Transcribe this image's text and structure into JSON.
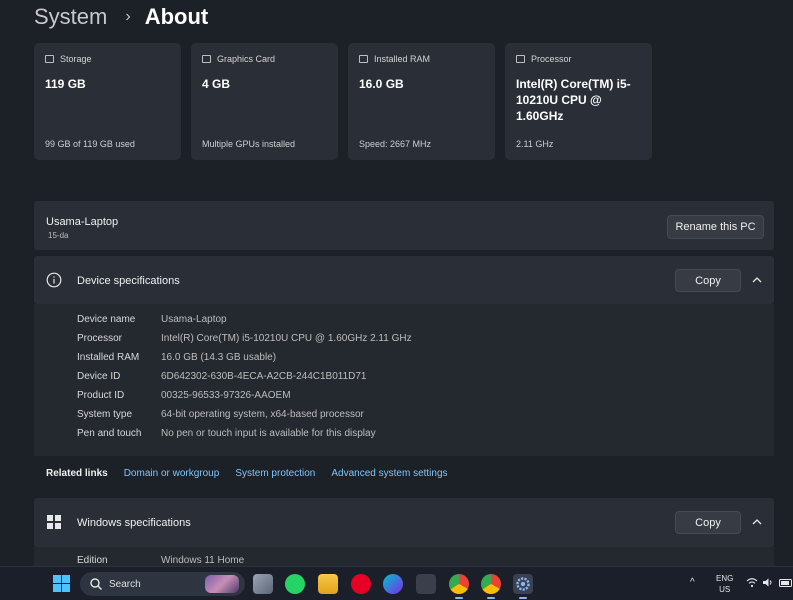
{
  "breadcrumb": {
    "parent": "System",
    "separator": "›",
    "current": "About"
  },
  "cards": [
    {
      "title": "Storage",
      "value": "119 GB",
      "sub": "99 GB of 119 GB used",
      "icon": "storage-icon"
    },
    {
      "title": "Graphics Card",
      "value": "4 GB",
      "sub": "Multiple GPUs installed",
      "icon": "graphics-card-icon"
    },
    {
      "title": "Installed RAM",
      "value": "16.0 GB",
      "sub": "Speed: 2667 MHz",
      "icon": "ram-icon"
    },
    {
      "title": "Processor",
      "value": "Intel(R) Core(TM) i5-10210U CPU @ 1.60GHz",
      "sub": "2.11 GHz",
      "icon": "processor-icon"
    }
  ],
  "pc": {
    "name": "Usama-Laptop",
    "model": "15-da",
    "rename_label": "Rename this PC"
  },
  "device_specs": {
    "title": "Device specifications",
    "copy_label": "Copy",
    "rows": [
      {
        "label": "Device name",
        "value": "Usama-Laptop"
      },
      {
        "label": "Processor",
        "value": "Intel(R) Core(TM) i5-10210U CPU @ 1.60GHz   2.11 GHz"
      },
      {
        "label": "Installed RAM",
        "value": "16.0 GB (14.3 GB usable)"
      },
      {
        "label": "Device ID",
        "value": "6D642302-630B-4ECA-A2CB-244C1B011D71"
      },
      {
        "label": "Product ID",
        "value": "00325-96533-97326-AAOEM"
      },
      {
        "label": "System type",
        "value": "64-bit operating system, x64-based processor"
      },
      {
        "label": "Pen and touch",
        "value": "No pen or touch input is available for this display"
      }
    ]
  },
  "related_links": {
    "title": "Related links",
    "links": [
      "Domain or workgroup",
      "System protection",
      "Advanced system settings"
    ]
  },
  "windows_specs": {
    "title": "Windows specifications",
    "copy_label": "Copy",
    "rows": [
      {
        "label": "Edition",
        "value": "Windows 11 Home"
      }
    ]
  },
  "taskbar": {
    "search_label": "Search",
    "tray_arrow": "^",
    "lang_line1": "ENG",
    "lang_line2": "US",
    "apps": [
      "task-view-icon",
      "whatsapp-icon",
      "file-explorer-icon",
      "pinterest-icon",
      "canva-icon",
      "app-icon",
      "chrome-icon",
      "chrome-profile-icon",
      "settings-icon"
    ]
  },
  "colors": {
    "background": "#1c2027",
    "card": "#2a2e36",
    "link": "#7cc6ff",
    "accent": "#4cc2ff"
  }
}
